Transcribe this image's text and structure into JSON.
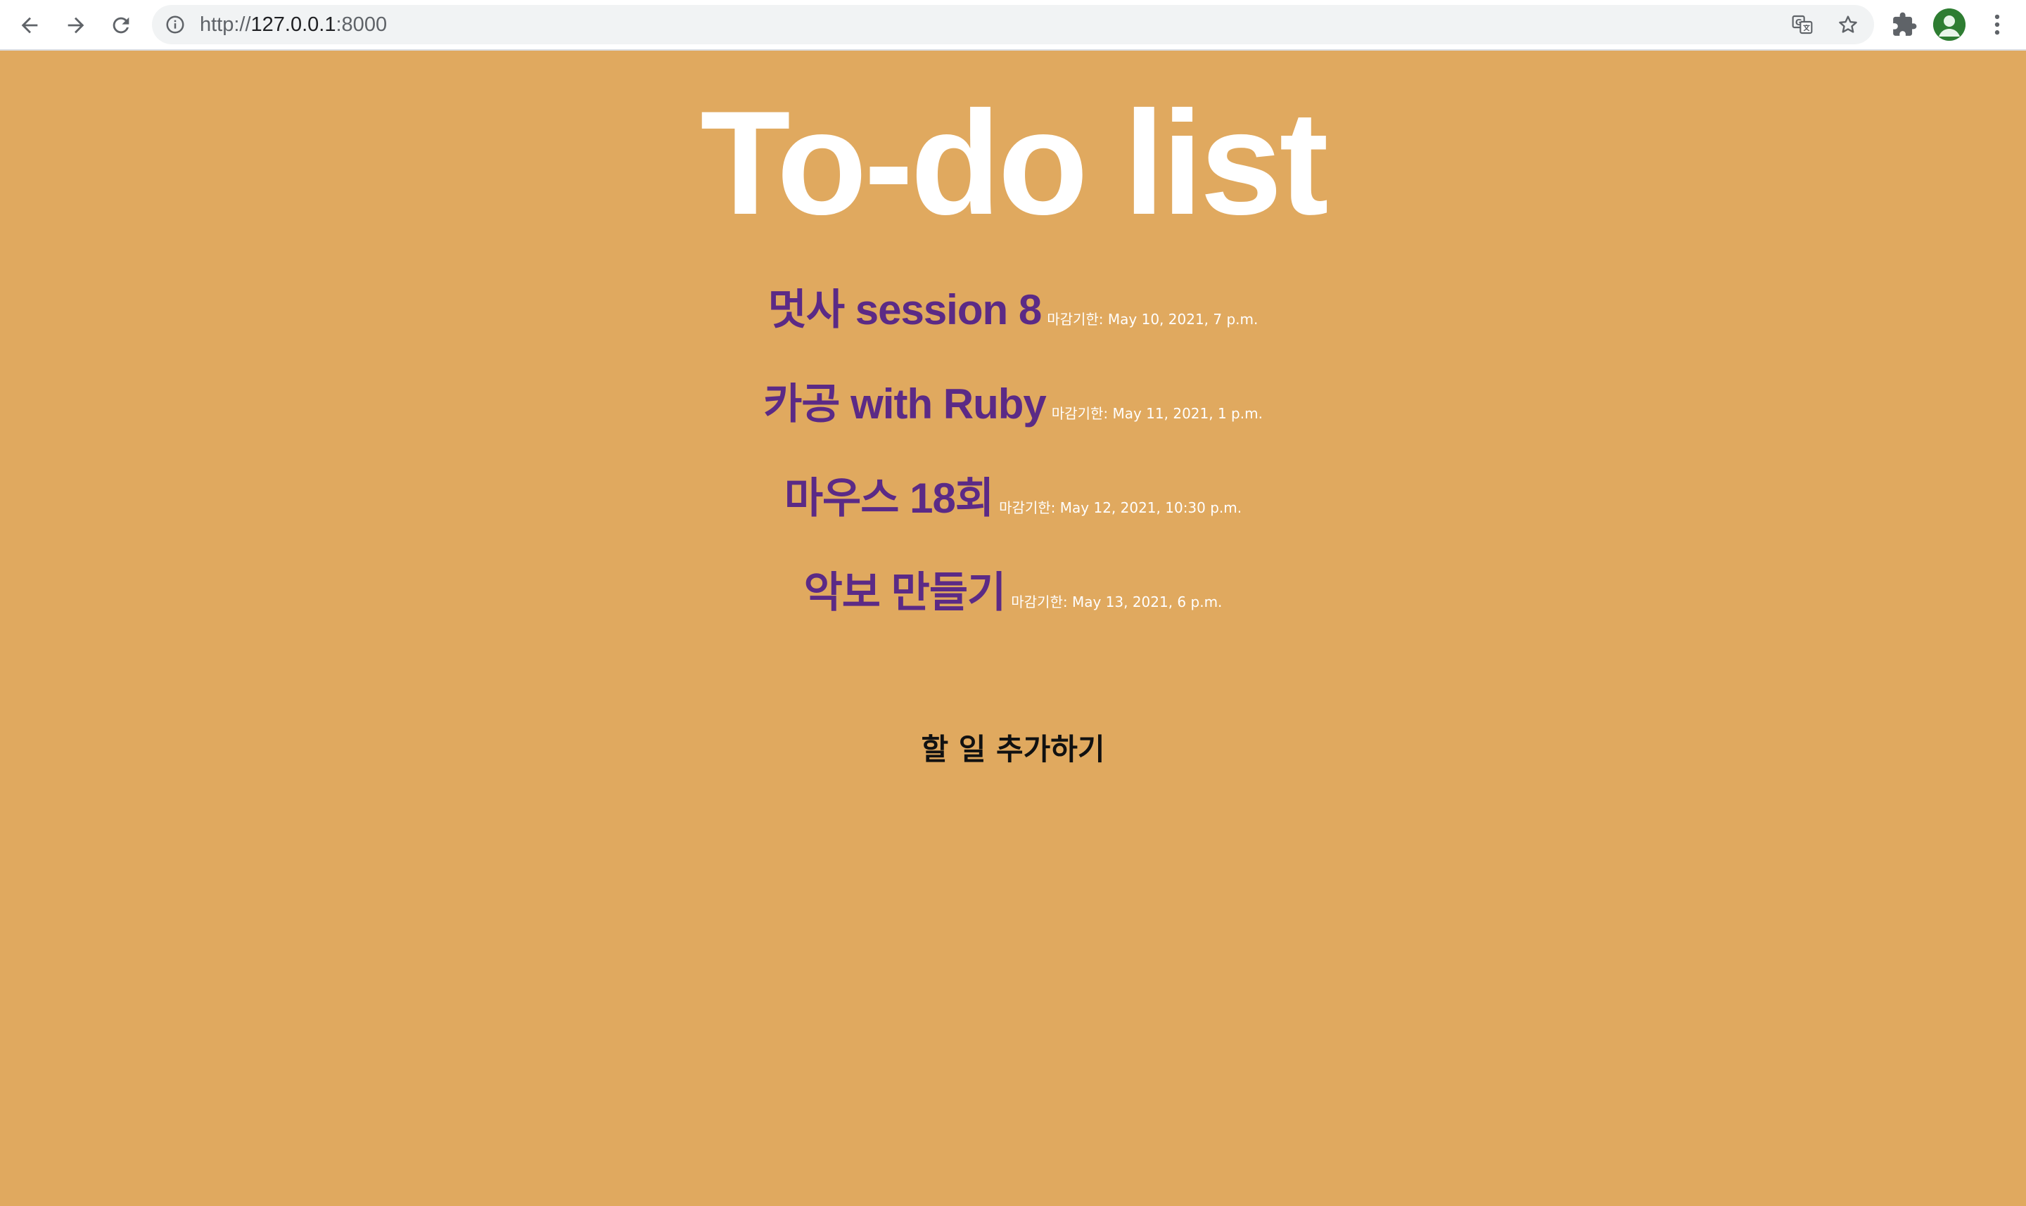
{
  "browser": {
    "url_scheme": "http://",
    "url_host": "127.0.0.1",
    "url_port": ":8000"
  },
  "icons": {
    "back": "back-arrow-icon",
    "forward": "forward-arrow-icon",
    "reload": "reload-icon",
    "site_info": "info-icon",
    "translate": "translate-icon",
    "bookmark": "star-icon",
    "extensions": "puzzle-icon",
    "profile": "avatar-icon",
    "menu": "kebab-menu-icon"
  },
  "colors": {
    "page_background": "#e0a95f",
    "title": "#ffffff",
    "todo_title": "#5b2a86",
    "deadline": "#ffffff",
    "add_link": "#111111"
  },
  "page": {
    "title": "To-do list",
    "todos": [
      {
        "title": "멋사 session 8",
        "deadline": "마감기한: May 10, 2021, 7 p.m."
      },
      {
        "title": "카공 with Ruby",
        "deadline": "마감기한: May 11, 2021, 1 p.m."
      },
      {
        "title": "마우스 18회",
        "deadline": "마감기한: May 12, 2021, 10:30 p.m."
      },
      {
        "title": "악보 만들기",
        "deadline": "마감기한: May 13, 2021, 6 p.m."
      }
    ],
    "add_label": "할 일 추가하기"
  }
}
